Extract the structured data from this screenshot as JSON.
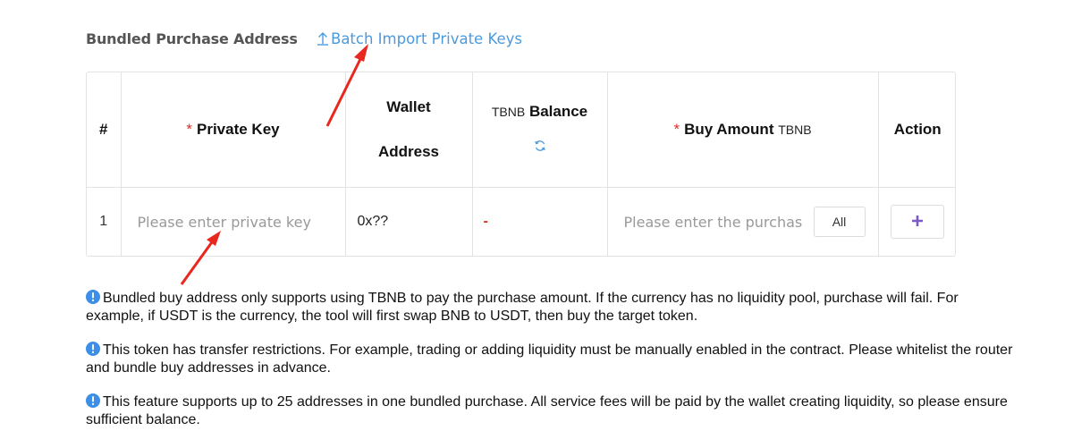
{
  "header": {
    "section_title": "Bundled Purchase Address",
    "batch_import_label": "Batch Import Private Keys"
  },
  "table": {
    "columns": {
      "index": "#",
      "private_key": "Private Key",
      "wallet_line1": "Wallet",
      "wallet_line2": "Address",
      "balance_unit": "TBNB",
      "balance_label": "Balance",
      "buy_amount": "Buy Amount",
      "buy_unit": "TBNB",
      "action": "Action"
    },
    "required_mark": "*",
    "rows": [
      {
        "index": "1",
        "private_key_placeholder": "Please enter private key",
        "wallet_address": "0x??",
        "balance": "-",
        "buy_amount_placeholder": "Please enter the purchase amount",
        "all_label": "All",
        "add_label": "+"
      }
    ]
  },
  "notes": [
    "Bundled buy address only supports using TBNB to pay the purchase amount. If the currency has no liquidity pool, purchase will fail. For example, if USDT is the currency, the tool will first swap BNB to USDT, then buy the target token.",
    "This token has transfer restrictions. For example, trading or adding liquidity must be manually enabled in the contract. Please whitelist the router and bundle buy addresses in advance.",
    "This feature supports up to 25 addresses in one bundled purchase. All service fees will be paid by the wallet creating liquidity, so please ensure sufficient balance."
  ],
  "colors": {
    "link": "#4a9ae0",
    "required": "#d93025",
    "info": "#3d8ee6",
    "add": "#7b5cc4",
    "arrow": "#e8271f"
  },
  "icons": {
    "batch": "upload-icon",
    "refresh": "refresh-icon",
    "info": "info-icon",
    "add": "plus-icon"
  }
}
